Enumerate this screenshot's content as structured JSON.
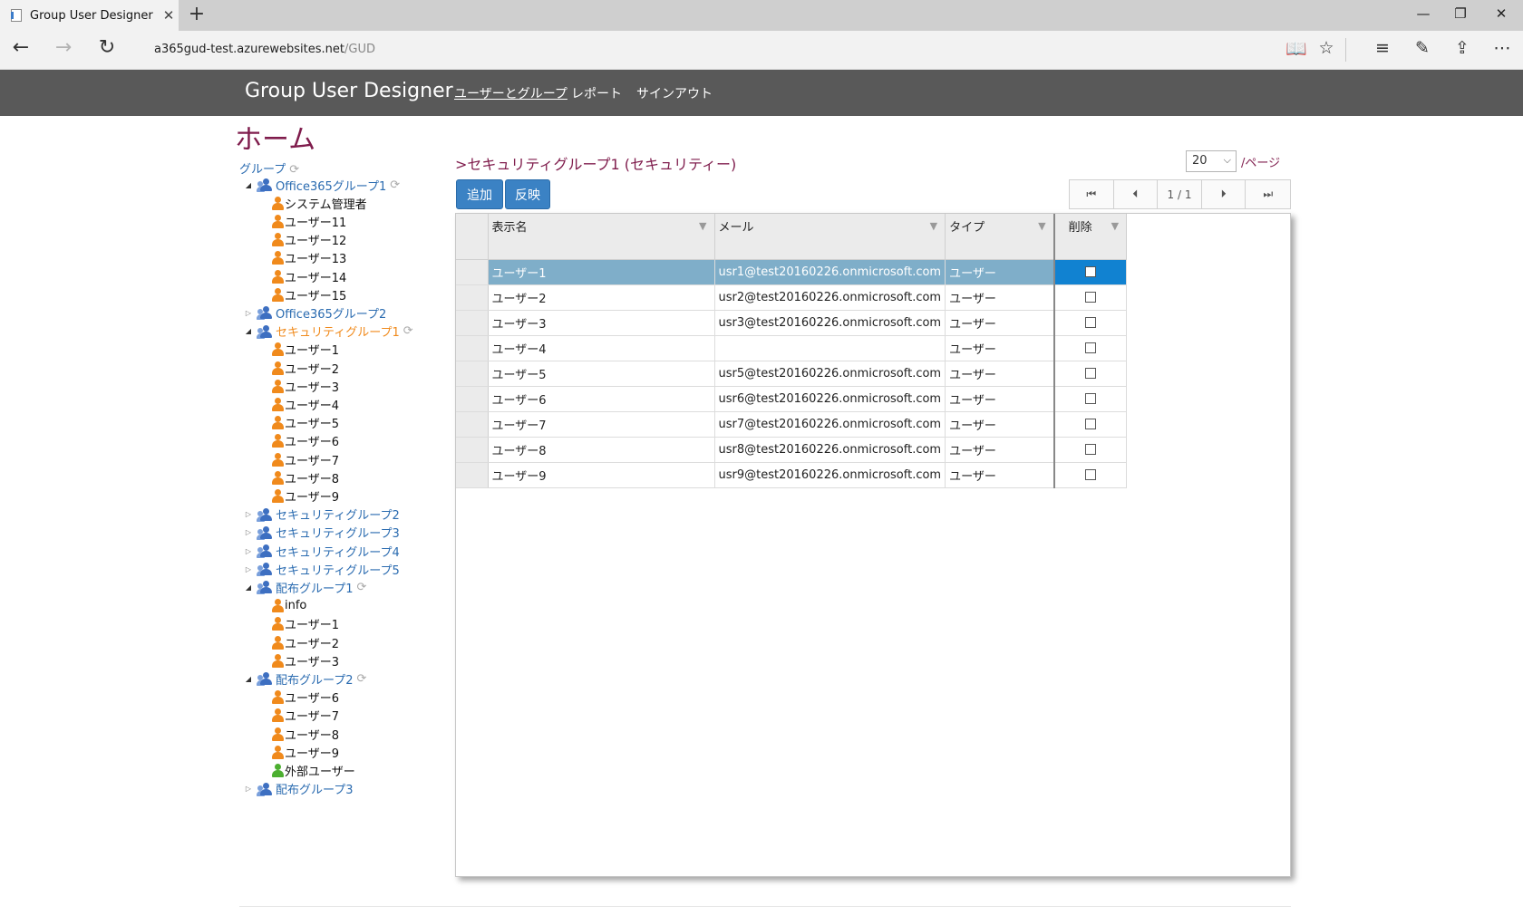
{
  "browser": {
    "tab_title": "Group User Designer",
    "tab_close": "✕",
    "new_tab": "+",
    "url_host": "a365gud-test.azurewebsites.net",
    "url_path": "/GUD"
  },
  "header": {
    "brand": "Group User Designer",
    "nav": [
      "ユーザーとグループ",
      "レポート",
      "サインアウト"
    ]
  },
  "page_title": "ホーム",
  "tree": {
    "root_label": "グループ",
    "nodes": [
      {
        "kind": "group",
        "label": "Office365グループ1",
        "expanded": true,
        "refresh": true
      },
      {
        "kind": "user",
        "label": "システム管理者"
      },
      {
        "kind": "user",
        "label": "ユーザー11"
      },
      {
        "kind": "user",
        "label": "ユーザー12"
      },
      {
        "kind": "user",
        "label": "ユーザー13"
      },
      {
        "kind": "user",
        "label": "ユーザー14"
      },
      {
        "kind": "user",
        "label": "ユーザー15"
      },
      {
        "kind": "group",
        "label": "Office365グループ2",
        "expanded": false
      },
      {
        "kind": "group",
        "label": "セキュリティグループ1",
        "expanded": true,
        "selected": true,
        "refresh": true
      },
      {
        "kind": "user",
        "label": "ユーザー1"
      },
      {
        "kind": "user",
        "label": "ユーザー2"
      },
      {
        "kind": "user",
        "label": "ユーザー3"
      },
      {
        "kind": "user",
        "label": "ユーザー4"
      },
      {
        "kind": "user",
        "label": "ユーザー5"
      },
      {
        "kind": "user",
        "label": "ユーザー6"
      },
      {
        "kind": "user",
        "label": "ユーザー7"
      },
      {
        "kind": "user",
        "label": "ユーザー8"
      },
      {
        "kind": "user",
        "label": "ユーザー9"
      },
      {
        "kind": "group",
        "label": "セキュリティグループ2",
        "expanded": false
      },
      {
        "kind": "group",
        "label": "セキュリティグループ3",
        "expanded": false
      },
      {
        "kind": "group",
        "label": "セキュリティグループ4",
        "expanded": false
      },
      {
        "kind": "group",
        "label": "セキュリティグループ5",
        "expanded": false
      },
      {
        "kind": "group",
        "label": "配布グループ1",
        "expanded": true,
        "refresh": true
      },
      {
        "kind": "user",
        "label": "info"
      },
      {
        "kind": "user",
        "label": "ユーザー1"
      },
      {
        "kind": "user",
        "label": "ユーザー2"
      },
      {
        "kind": "user",
        "label": "ユーザー3"
      },
      {
        "kind": "group",
        "label": "配布グループ2",
        "expanded": true,
        "refresh": true
      },
      {
        "kind": "user",
        "label": "ユーザー6"
      },
      {
        "kind": "user",
        "label": "ユーザー7"
      },
      {
        "kind": "user",
        "label": "ユーザー8"
      },
      {
        "kind": "user",
        "label": "ユーザー9"
      },
      {
        "kind": "external",
        "label": "外部ユーザー"
      },
      {
        "kind": "group",
        "label": "配布グループ3",
        "expanded": false
      }
    ]
  },
  "content": {
    "breadcrumb": ">セキュリティグループ1 (セキュリティー)",
    "page_size": "20",
    "per_page_label": "/ページ",
    "add_button": "追加",
    "apply_button": "反映",
    "pager_text": "1 / 1"
  },
  "grid": {
    "columns": [
      "表示名",
      "メール",
      "タイプ",
      "削除"
    ],
    "rows": [
      {
        "name": "ユーザー1",
        "mail": "usr1@test20160226.onmicrosoft.com",
        "type": "ユーザー",
        "selected": true
      },
      {
        "name": "ユーザー2",
        "mail": "usr2@test20160226.onmicrosoft.com",
        "type": "ユーザー"
      },
      {
        "name": "ユーザー3",
        "mail": "usr3@test20160226.onmicrosoft.com",
        "type": "ユーザー"
      },
      {
        "name": "ユーザー4",
        "mail": "",
        "type": "ユーザー"
      },
      {
        "name": "ユーザー5",
        "mail": "usr5@test20160226.onmicrosoft.com",
        "type": "ユーザー"
      },
      {
        "name": "ユーザー6",
        "mail": "usr6@test20160226.onmicrosoft.com",
        "type": "ユーザー"
      },
      {
        "name": "ユーザー7",
        "mail": "usr7@test20160226.onmicrosoft.com",
        "type": "ユーザー"
      },
      {
        "name": "ユーザー8",
        "mail": "usr8@test20160226.onmicrosoft.com",
        "type": "ユーザー"
      },
      {
        "name": "ユーザー9",
        "mail": "usr9@test20160226.onmicrosoft.com",
        "type": "ユーザー"
      }
    ]
  }
}
